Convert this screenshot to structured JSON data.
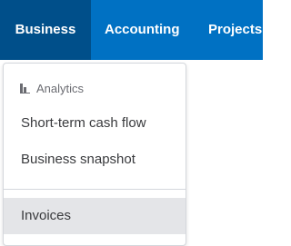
{
  "nav": {
    "items": [
      {
        "label": "Business",
        "active": true
      },
      {
        "label": "Accounting",
        "active": false
      },
      {
        "label": "Projects",
        "active": false
      }
    ],
    "bar_color": "#0071c3",
    "active_color": "#004f8a"
  },
  "dropdown": {
    "section": {
      "icon": "bar-chart-icon",
      "label": "Analytics"
    },
    "items": [
      {
        "label": "Short-term cash flow",
        "highlighted": false
      },
      {
        "label": "Business snapshot",
        "highlighted": false
      },
      {
        "label": "Invoices",
        "highlighted": true
      }
    ],
    "highlight_color": "#e4e5e8"
  }
}
